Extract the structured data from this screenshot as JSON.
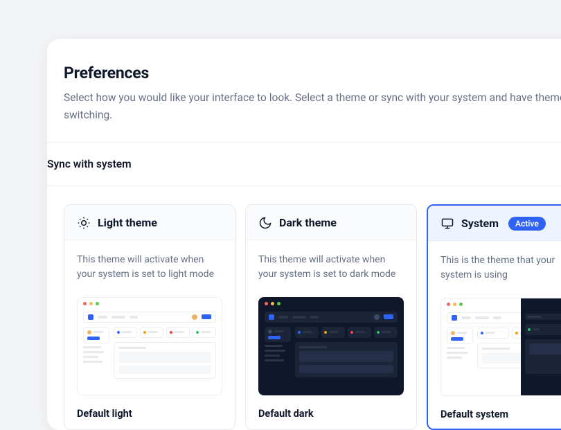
{
  "header": {
    "title": "Preferences",
    "subtitle": "Select how you would like your interface to look. Select a theme  or sync with your system and have theme switching."
  },
  "toggle": {
    "label": "Sync with system"
  },
  "cards": {
    "light": {
      "title": "Light theme",
      "desc": "This theme will activate when your system is set to light mode",
      "option": "Default light"
    },
    "dark": {
      "title": "Dark theme",
      "desc": "This theme will activate when your system is set to dark mode",
      "option": "Default dark"
    },
    "system": {
      "title": "System",
      "badge": "Active",
      "desc": "This is the theme that your system is using",
      "option": "Default system"
    }
  }
}
